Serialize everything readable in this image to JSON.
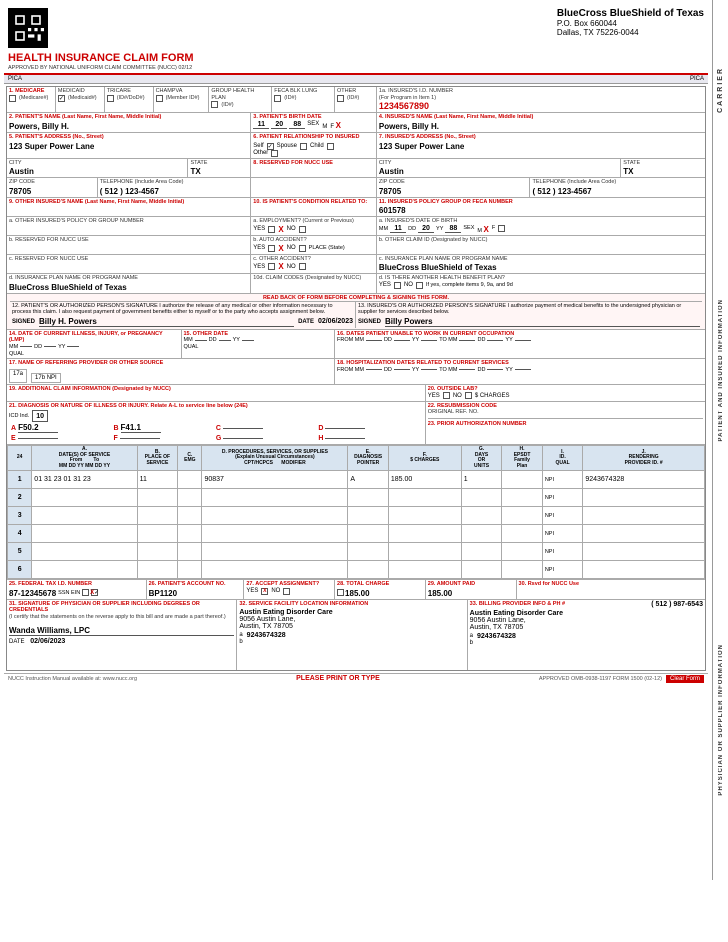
{
  "header": {
    "company": "BlueCross BlueShield of Texas",
    "po_box": "P.O. Box 660044",
    "city": "Dallas, TX 75226-0044",
    "form_title": "HEALTH INSURANCE CLAIM FORM",
    "approved": "APPROVED BY NATIONAL UNIFORM CLAIM COMMITTEE (NUCC) 02/12",
    "pica_left": "PICA",
    "pica_right": "PICA"
  },
  "insurance_type": {
    "medicare": {
      "label": "MEDICARE",
      "sub": "(Medicare#)",
      "checked": false
    },
    "medicaid": {
      "label": "MEDICAID",
      "sub": "(Medicaid#)",
      "checked": true
    },
    "tricare": {
      "label": "TRICARE",
      "sub": "(ID#/DoD#)",
      "checked": false
    },
    "champva": {
      "label": "CHAMPVA",
      "sub": "(Member ID#)",
      "checked": false
    },
    "group": {
      "label": "GROUP HEALTH PLAN",
      "sub": "(ID#)",
      "checked": false
    },
    "feca": {
      "label": "FECA BLK LUNG",
      "sub": "(ID#)",
      "checked": false
    },
    "other": {
      "label": "OTHER",
      "sub": "(ID#)",
      "checked": false
    },
    "insured_id_label": "1a. INSURED'S I.D. NUMBER",
    "insured_id_note": "(For Program in Item 1)",
    "insured_id_value": "1234567890"
  },
  "patient": {
    "name_label": "2. PATIENT'S NAME (Last Name, First Name, Middle Initial)",
    "name_value": "Powers, Billy H.",
    "dob_label": "3. PATIENT'S BIRTH DATE",
    "dob_mm": "11",
    "dob_dd": "20",
    "dob_yy": "88",
    "sex_m": false,
    "sex_f": true,
    "insured_name_label": "4. INSURED'S NAME (Last Name, First Name, Middle Initial)",
    "insured_name_value": "Powers, Billy H.",
    "address_label": "5. PATIENT'S ADDRESS (No., Street)",
    "address_value": "123 Super Power Lane",
    "relationship_label": "6. PATIENT RELATIONSHIP TO INSURED",
    "rel_self": true,
    "rel_spouse": false,
    "rel_child": false,
    "rel_other": false,
    "insured_address_label": "7. INSURED'S ADDRESS (No., Street)",
    "insured_address_value": "123 Super Power Lane",
    "city_label": "CITY",
    "city_value": "Austin",
    "state_label": "STATE",
    "state_value": "TX",
    "reserved_label": "8. RESERVED FOR NUCC USE",
    "insured_city_value": "Austin",
    "insured_state_value": "TX",
    "zip_label": "ZIP CODE",
    "zip_value": "78705",
    "phone_label": "TELEPHONE (Include Area Code)",
    "phone_value": "( 512 ) 123-4567",
    "insured_zip_value": "78705",
    "insured_phone_value": "( 512 ) 123-4567",
    "other_insured_label": "9. OTHER INSURED'S NAME (Last Name, First Name, Middle Initial)",
    "other_insured_value": "",
    "condition_label": "10. IS PATIENT'S CONDITION RELATED TO:",
    "policy_label": "11. INSURED'S POLICY GROUP OR FECA NUMBER",
    "policy_value": "601578",
    "policy_a_label": "a. OTHER INSURED'S POLICY OR GROUP NUMBER",
    "employment_label": "a. EMPLOYMENT? (Current or Previous)",
    "employment_yes": false,
    "employment_no": true,
    "insured_dob_label": "a. INSURED'S DATE OF BIRTH",
    "insured_dob_mm": "11",
    "insured_dob_dd": "20",
    "insured_dob_yy": "88",
    "insured_sex_m": true,
    "insured_sex_f": false,
    "reserved_b_label": "b. RESERVED FOR NUCC USE",
    "auto_label": "b. AUTO ACCIDENT?",
    "auto_yes": false,
    "auto_no": true,
    "auto_place": "PLACE (State)",
    "other_claim_label": "b. OTHER CLAIM ID (Designated by NUCC)",
    "reserved_c_label": "c. RESERVED FOR NUCC USE",
    "other_accident_label": "c. OTHER ACCIDENT?",
    "other_accident_yes": false,
    "other_accident_no": true,
    "insurance_plan_label_c": "c. INSURANCE PLAN NAME OR PROGRAM NAME",
    "insurance_plan_value_c": "BlueCross BlueShield of Texas",
    "insurance_plan_label_d": "d. INSURANCE PLAN NAME OR PROGRAM NAME",
    "insurance_plan_value_d": "BlueCross BlueShield of Texas",
    "claim_codes_label": "10d. CLAIM CODES (Designated by NUCC)",
    "another_benefit_label": "d. IS THERE ANOTHER HEALTH BENEFIT PLAN?",
    "another_yes": false,
    "another_no": false,
    "another_note": "If yes, complete items 9, 9a, and 9d"
  },
  "signatures": {
    "read_back_label": "READ BACK OF FORM BEFORE COMPLETING & SIGNING THIS FORM.",
    "patient_auth_text": "12. PATIENT'S OR AUTHORIZED PERSON'S SIGNATURE I authorize the release of any medical or other information necessary to process this claim. I also request payment of government benefits either to myself or to the party who accepts assignment below.",
    "signed_label": "SIGNED",
    "patient_signed": "Billy H. Powers",
    "date_label": "DATE",
    "patient_date": "02/06/2023",
    "insured_auth_text": "13. INSURED'S OR AUTHORIZED PERSON'S SIGNATURE I authorize payment of medical benefits to the undersigned physician or supplier for services described below.",
    "insured_signed": "Billy Powers"
  },
  "illness": {
    "illness_label": "14. DATE OF CURRENT ILLNESS, INJURY, or PREGNANCY (LMP)",
    "illness_mm": "",
    "illness_dd": "",
    "illness_yy": "",
    "qual_label": "QUAL",
    "other_date_label": "15. OTHER DATE",
    "other_mm": "",
    "other_dd": "",
    "other_yy": "",
    "unable_work_label": "16. DATES PATIENT UNABLE TO WORK IN CURRENT OCCUPATION",
    "from_label": "FROM",
    "to_label": "TO",
    "referring_label": "17. NAME OF REFERRING PROVIDER OR OTHER SOURCE",
    "referring_17a": "17a",
    "referring_17b": "17b NPI",
    "hospitalization_label": "18. HOSPITALIZATION DATES RELATED TO CURRENT SERVICES",
    "hosp_from_label": "FROM",
    "hosp_to_label": "TO",
    "additional_label": "19. ADDITIONAL CLAIM INFORMATION (Designated by NUCC)",
    "outside_lab_label": "20. OUTSIDE LAB?",
    "outside_yes": false,
    "outside_no": false,
    "charges_label": "$ CHARGES",
    "diagnosis_label": "21. DIAGNOSIS OR NATURE OF ILLNESS OR INJURY. Relate A-L to service line below (24E)",
    "icd_label": "ICD Ind.",
    "icd_value": "10",
    "resubmission_label": "22. RESUBMISSION CODE",
    "original_ref_label": "ORIGINAL REF. NO.",
    "prior_auth_label": "23. PRIOR AUTHORIZATION NUMBER",
    "diag_A": "F50.2",
    "diag_B": "F41.1",
    "diag_C": "",
    "diag_D": "",
    "diag_E": "",
    "diag_F": "",
    "diag_G": "",
    "diag_H": ""
  },
  "service_table": {
    "col_a_date_from": "DATE(S) OF SERVICE From",
    "col_b_place": "B. PLACE OF SERVICE",
    "col_c_emg": "C. EMG",
    "col_d_procedures": "D. PROCEDURES, SERVICES, OR SUPPLIES (Explain Unusual Circumstances) CPT/HCPCS MODIFIER",
    "col_e_diagnosis": "E. DIAGNOSIS POINTER",
    "col_f_charges": "F. $ CHARGES",
    "col_g_days": "G. DAYS OR UNITS",
    "col_h_epsdt": "H. EPSDT Family Plan",
    "col_i_id": "I. ID. QUAL",
    "col_j_rendering": "J. RENDERING PROVIDER ID. #",
    "lines": [
      {
        "num": "1",
        "from_mm": "01",
        "from_dd": "31",
        "from_yy": "23",
        "to_mm": "01",
        "to_dd": "31",
        "to_yy": "23",
        "pos": "11",
        "emg": "",
        "cpt": "90837",
        "modifier": "",
        "diag_ptr": "A",
        "charges": "185.00",
        "days": "1",
        "epsdt": "",
        "id_qual": "NPI",
        "rendering": "9243674328"
      },
      {
        "num": "2",
        "from_mm": "",
        "from_dd": "",
        "from_yy": "",
        "to_mm": "",
        "to_dd": "",
        "to_yy": "",
        "pos": "",
        "emg": "",
        "cpt": "",
        "modifier": "",
        "diag_ptr": "",
        "charges": "",
        "days": "",
        "epsdt": "",
        "id_qual": "NPI",
        "rendering": ""
      },
      {
        "num": "3",
        "from_mm": "",
        "from_dd": "",
        "from_yy": "",
        "to_mm": "",
        "to_dd": "",
        "to_yy": "",
        "pos": "",
        "emg": "",
        "cpt": "",
        "modifier": "",
        "diag_ptr": "",
        "charges": "",
        "days": "",
        "epsdt": "",
        "id_qual": "NPI",
        "rendering": ""
      },
      {
        "num": "4",
        "from_mm": "",
        "from_dd": "",
        "from_yy": "",
        "to_mm": "",
        "to_dd": "",
        "to_yy": "",
        "pos": "",
        "emg": "",
        "cpt": "",
        "modifier": "",
        "diag_ptr": "",
        "charges": "",
        "days": "",
        "epsdt": "",
        "id_qual": "NPI",
        "rendering": ""
      },
      {
        "num": "5",
        "from_mm": "",
        "from_dd": "",
        "from_yy": "",
        "to_mm": "",
        "to_dd": "",
        "to_yy": "",
        "pos": "",
        "emg": "",
        "cpt": "",
        "modifier": "",
        "diag_ptr": "",
        "charges": "",
        "days": "",
        "epsdt": "",
        "id_qual": "NPI",
        "rendering": ""
      },
      {
        "num": "6",
        "from_mm": "",
        "from_dd": "",
        "from_yy": "",
        "to_mm": "",
        "to_dd": "",
        "to_yy": "",
        "pos": "",
        "emg": "",
        "cpt": "",
        "modifier": "",
        "diag_ptr": "",
        "charges": "",
        "days": "",
        "epsdt": "",
        "id_qual": "NPI",
        "rendering": ""
      }
    ]
  },
  "billing": {
    "federal_tax_label": "25. FEDERAL TAX I.D. NUMBER",
    "federal_tax_value": "87-12345678",
    "ssn_ein_label": "SSN EIN",
    "ein_checked": true,
    "patient_acct_label": "26. PATIENT'S ACCOUNT NO.",
    "patient_acct_value": "BP1120",
    "accept_label": "27. ACCEPT ASSIGNMENT?",
    "accept_yes": true,
    "accept_no": false,
    "total_charge_label": "28. TOTAL CHARGE",
    "total_charge_value": "185.00",
    "amount_paid_label": "29. AMOUNT PAID",
    "amount_paid_value": "185.00",
    "reserved_label": "30. Rsvd for NUCC Use",
    "physician_sig_label": "31. SIGNATURE OF PHYSICIAN OR SUPPLIER INCLUDING DEGREES OR CREDENTIALS",
    "physician_sig_note": "(I certify that the statements on the reverse apply to this bill and are made a part thereof.)",
    "physician_signed": "Wanda Williams, LPC",
    "physician_date": "02/06/2023",
    "facility_label": "32. SERVICE FACILITY LOCATION INFORMATION",
    "facility_name": "Austin Eating Disorder Care",
    "facility_address": "9056 Austin Lane,",
    "facility_city": "Austin, TX 78705",
    "facility_npi_label": "a",
    "facility_npi": "9243674328",
    "facility_b_label": "b",
    "billing_label": "33. BILLING PROVIDER INFO & PH #",
    "billing_phone": "( 512 ) 987-6543",
    "billing_name": "Austin Eating Disorder Care",
    "billing_address": "9056 Austin Lane,",
    "billing_city": "Austin, TX 78705",
    "billing_npi_label": "a",
    "billing_npi": "9243674328",
    "billing_b_label": "b"
  },
  "footer": {
    "nucc_text": "NUCC Instruction Manual available at: www.nucc.org",
    "print_text": "PLEASE PRINT OR TYPE",
    "approved_text": "APPROVED OMB-0938-1197 FORM 1500 (02-12)",
    "clear_button": "Clear Form"
  },
  "side_labels": {
    "carrier": "CARRIER",
    "patient_insured": "PATIENT AND INSURED INFORMATION",
    "physician_supplier": "PHYSICIAN OR SUPPLIER INFORMATION"
  }
}
